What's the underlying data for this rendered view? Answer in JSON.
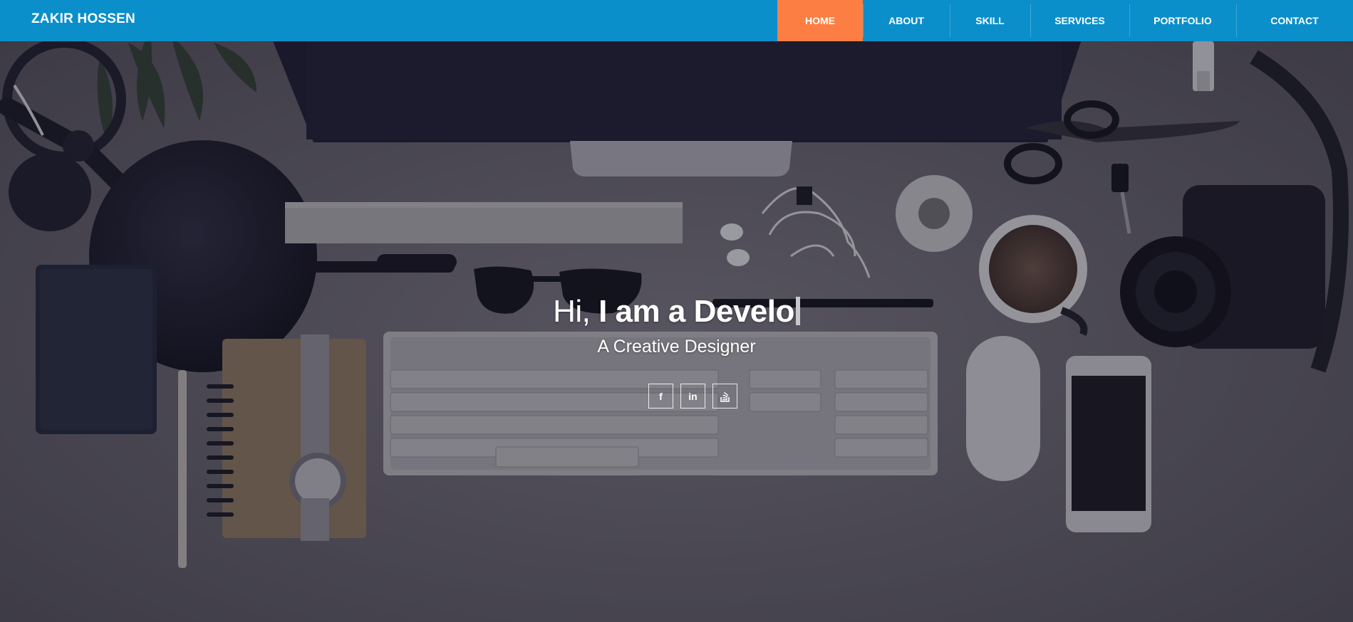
{
  "brand": {
    "name": "ZAKIR HOSSEN"
  },
  "nav": {
    "items": [
      {
        "label": "HOME",
        "active": true
      },
      {
        "label": "ABOUT"
      },
      {
        "label": "SKILL"
      },
      {
        "label": "SERVICES"
      },
      {
        "label": "PORTFOLIO"
      },
      {
        "label": "CONTACT"
      }
    ]
  },
  "hero": {
    "greeting": "Hi, ",
    "typed_text": "I am a Develo",
    "subtitle": "A Creative Designer",
    "socials": [
      {
        "icon": "facebook-icon",
        "glyph": "f"
      },
      {
        "icon": "linkedin-icon",
        "glyph": "in"
      },
      {
        "icon": "stack-overflow-icon",
        "glyph": ""
      }
    ]
  },
  "colors": {
    "navbar": "#0a8fcb",
    "active_nav": "#fc7e43",
    "text": "#ffffff"
  }
}
